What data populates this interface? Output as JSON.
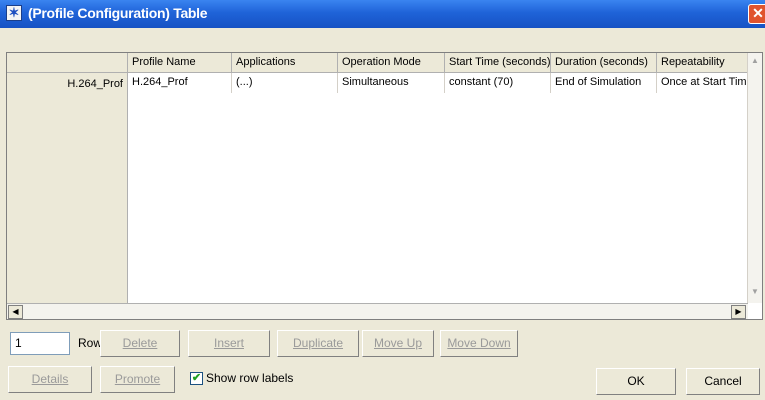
{
  "window": {
    "title": "(Profile Configuration) Table",
    "close_glyph": "✕",
    "icon_glyph": "✶"
  },
  "table": {
    "columns": [
      "Profile Name",
      "Applications",
      "Operation Mode",
      "Start Time (seconds)",
      "Duration (seconds)",
      "Repeatability"
    ],
    "rows": [
      {
        "label": "H.264_Prof",
        "cells": [
          "H.264_Prof",
          "(...)",
          "Simultaneous",
          "constant (70)",
          "End of Simulation",
          "Once at Start Time"
        ]
      }
    ]
  },
  "rows_control": {
    "value": "1",
    "label": "Rows"
  },
  "buttons": {
    "delete": "Delete",
    "insert": "Insert",
    "duplicate": "Duplicate",
    "move_up": "Move Up",
    "move_down": "Move Down",
    "details": "Details",
    "promote": "Promote",
    "ok": "OK",
    "cancel": "Cancel"
  },
  "show_row_labels": {
    "label": "Show row labels",
    "checked": true
  }
}
